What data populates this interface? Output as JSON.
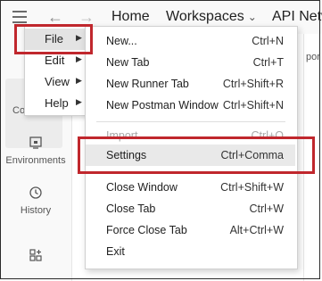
{
  "topbar": {
    "home": "Home",
    "workspaces": "Workspaces",
    "api_network": "API Netw"
  },
  "sidebar": {
    "collections_fragment": "Co",
    "environments": "Environments",
    "history": "History"
  },
  "right_fragment": "por",
  "main_menu": {
    "items": [
      {
        "label": "File"
      },
      {
        "label": "Edit"
      },
      {
        "label": "View"
      },
      {
        "label": "Help"
      }
    ]
  },
  "file_menu": {
    "items": [
      {
        "label": "New...",
        "shortcut": "Ctrl+N"
      },
      {
        "label": "New Tab",
        "shortcut": "Ctrl+T"
      },
      {
        "label": "New Runner Tab",
        "shortcut": "Ctrl+Shift+R"
      },
      {
        "label": "New Postman Window",
        "shortcut": "Ctrl+Shift+N"
      },
      {
        "label": "Import...",
        "shortcut": "Ctrl+O"
      },
      {
        "label": "Settings",
        "shortcut": "Ctrl+Comma"
      },
      {
        "label": "Close Window",
        "shortcut": "Ctrl+Shift+W"
      },
      {
        "label": "Close Tab",
        "shortcut": "Ctrl+W"
      },
      {
        "label": "Force Close Tab",
        "shortcut": "Alt+Ctrl+W"
      },
      {
        "label": "Exit",
        "shortcut": ""
      }
    ]
  },
  "colors": {
    "highlight": "#c0272d",
    "menu_hover": "#e3e3e3"
  }
}
